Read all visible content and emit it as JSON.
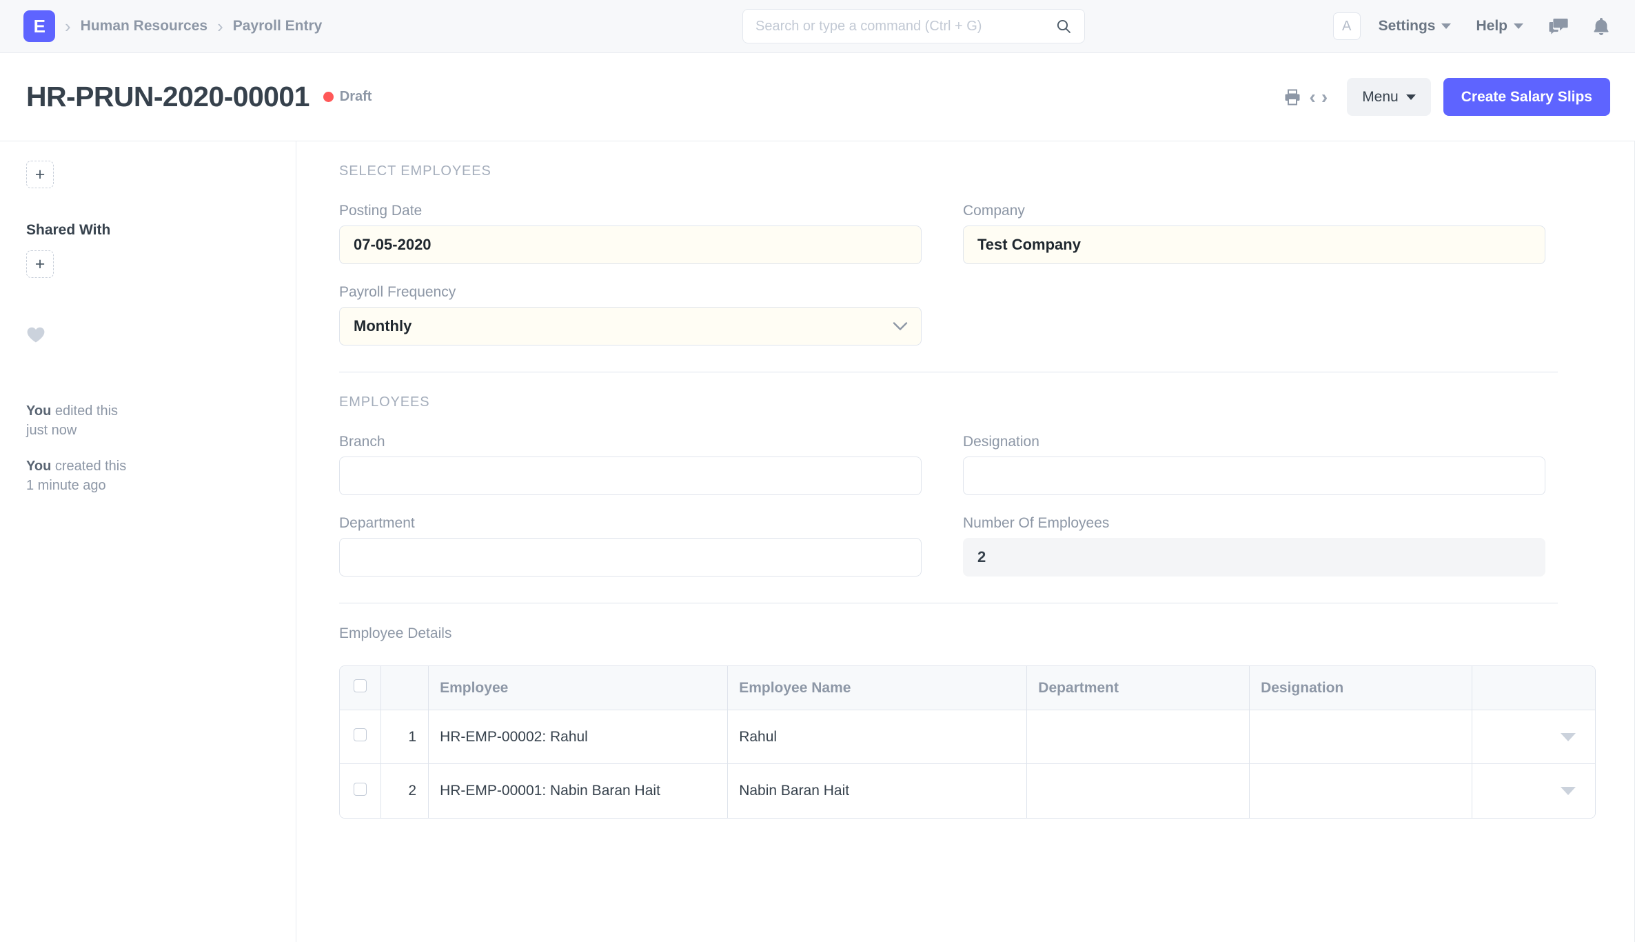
{
  "navbar": {
    "logo_letter": "E",
    "breadcrumbs": [
      {
        "label": "Human Resources"
      },
      {
        "label": "Payroll Entry"
      }
    ],
    "search": {
      "value": "",
      "placeholder": "Search or type a command (Ctrl + G)"
    },
    "avatar_letter": "A",
    "settings_label": "Settings",
    "help_label": "Help",
    "icons": [
      "search-icon",
      "chat-icon",
      "notification-bell-icon"
    ]
  },
  "page_head": {
    "title": "HR-PRUN-2020-00001",
    "status": "Draft",
    "status_color": "#ff5858",
    "menu_label": "Menu",
    "primary_button": "Create Salary Slips",
    "icons": [
      "print-icon",
      "prev-arrow-icon",
      "next-arrow-icon"
    ]
  },
  "sidebar": {
    "add_assignment_label": "+",
    "shared_with_label": "Shared With",
    "add_share_label": "+",
    "activity": [
      {
        "actor": "You",
        "action": " edited this",
        "time": "just now"
      },
      {
        "actor": "You",
        "action": " created this",
        "time": "1 minute ago"
      }
    ]
  },
  "form": {
    "select_employees": {
      "title": "Select Employees",
      "fields": {
        "posting_date": {
          "label": "Posting Date",
          "value": "07-05-2020"
        },
        "company": {
          "label": "Company",
          "value": "Test Company"
        },
        "payroll_frequency": {
          "label": "Payroll Frequency",
          "value": "Monthly"
        }
      }
    },
    "employees": {
      "title": "Employees",
      "fields": {
        "branch": {
          "label": "Branch",
          "value": ""
        },
        "designation": {
          "label": "Designation",
          "value": ""
        },
        "department": {
          "label": "Department",
          "value": ""
        },
        "number_of_employees": {
          "label": "Number Of Employees",
          "value": "2"
        }
      }
    },
    "employee_details": {
      "title": "Employee Details",
      "columns": [
        "Employee",
        "Employee Name",
        "Department",
        "Designation"
      ],
      "rows": [
        {
          "idx": "1",
          "employee": "HR-EMP-00002: Rahul",
          "employee_name": "Rahul",
          "department": "",
          "designation": ""
        },
        {
          "idx": "2",
          "employee": "HR-EMP-00001: Nabin Baran Hait",
          "employee_name": "Nabin Baran Hait",
          "department": "",
          "designation": ""
        }
      ]
    }
  }
}
